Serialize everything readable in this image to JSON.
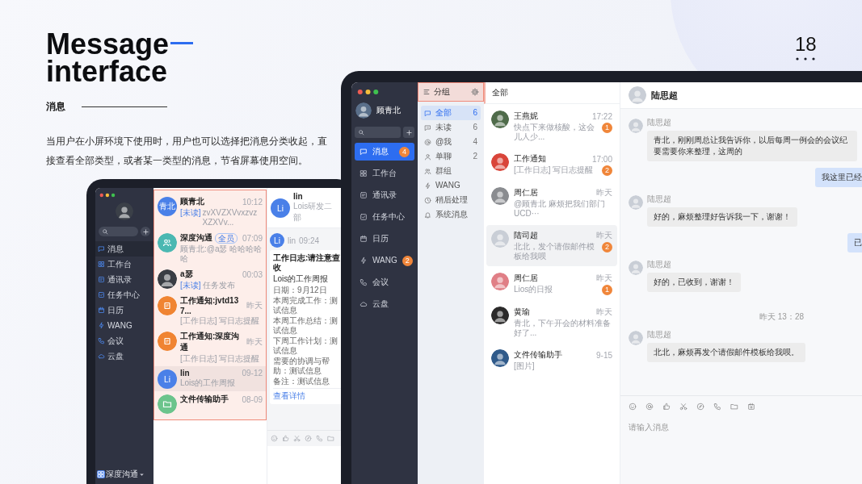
{
  "slide": {
    "title": [
      "Message",
      "interface"
    ],
    "section": "消息",
    "description": "当用户在小屏环境下使用时，用户也可以选择把消息分类收起，直接查看全部类型，或者某一类型的消息，节省屏幕使用空间。",
    "page_number": "18"
  },
  "small_app": {
    "user_avatar": {
      "kind": "photo",
      "color": "#3b4048"
    },
    "nav": [
      {
        "label": "消息",
        "selected": true
      },
      {
        "label": "工作台",
        "selected": false
      },
      {
        "label": "通讯录",
        "selected": false
      },
      {
        "label": "任务中心",
        "selected": false
      },
      {
        "label": "日历",
        "selected": false
      },
      {
        "label": "WANG",
        "selected": false
      },
      {
        "label": "会议",
        "selected": false
      },
      {
        "label": "云盘",
        "selected": false
      }
    ],
    "footer": "深度沟通",
    "conversations": [
      {
        "avatar": {
          "kind": "text",
          "text": "青北",
          "color": "#4a80e8"
        },
        "name": "顾青北",
        "time": "10:12",
        "unread_tag": "[未读]",
        "preview": "zvXVZXVvxzvzXZXVv...",
        "selected": false
      },
      {
        "avatar": {
          "kind": "icon",
          "color": "#4bb8b2"
        },
        "name": "深度沟通",
        "tag": "全员",
        "time": "07:09",
        "preview": "顾青北:@a瑟 哈哈哈哈哈",
        "selected": false
      },
      {
        "avatar": {
          "kind": "photo",
          "color": "#3a3d44"
        },
        "name": "a瑟",
        "time": "00:03",
        "unread_tag": "[未读]",
        "preview": "任务发布",
        "selected": false
      },
      {
        "avatar": {
          "kind": "icon",
          "color": "#f08432"
        },
        "name": "工作通知:jvtd137...",
        "time": "昨天",
        "preview": "[工作日志] 写日志提醒",
        "selected": false
      },
      {
        "avatar": {
          "kind": "icon",
          "color": "#f08432"
        },
        "name": "工作通知:深度沟通",
        "time": "昨天",
        "preview": "[工作日志] 写日志提醒",
        "selected": false
      },
      {
        "avatar": {
          "kind": "text",
          "text": "Li",
          "color": "#4a80e8"
        },
        "name": "lin",
        "time": "09-12",
        "preview": "Lois的工作周报",
        "selected": true
      },
      {
        "avatar": {
          "kind": "icon",
          "color": "#6cc48c"
        },
        "name": "文件传输助手",
        "time": "08-09",
        "selected": false
      }
    ],
    "chat": {
      "avatar": {
        "kind": "text",
        "text": "Li",
        "color": "#4a80e8"
      },
      "name": "lin",
      "subtitle": "Lois研发二部",
      "message": {
        "avatar": {
          "kind": "text",
          "text": "Li",
          "color": "#4a80e8"
        },
        "sender": "lin",
        "time": "09:24",
        "card": {
          "title": "工作日志:请注意查收",
          "subtitle": "Lois的工作周报",
          "lines": [
            "日期：9月12日",
            "本周完成工作：测试信息",
            "本周工作总结：测试信息",
            "下周工作计划：测试信息",
            "需要的协调与帮助：测试信息",
            "备注：测试信息"
          ],
          "link": "查看详情"
        }
      }
    }
  },
  "big_app": {
    "user": {
      "name": "顾青北",
      "avatar": {
        "kind": "photo",
        "color": "#5a6f8a"
      }
    },
    "nav": [
      {
        "label": "消息",
        "selected": true,
        "badge": "4"
      },
      {
        "label": "工作台",
        "selected": false
      },
      {
        "label": "通讯录",
        "selected": false
      },
      {
        "label": "任务中心",
        "selected": false
      },
      {
        "label": "日历",
        "selected": false
      },
      {
        "label": "WANG",
        "selected": false,
        "badge": "2"
      },
      {
        "label": "会议",
        "selected": false
      },
      {
        "label": "云盘",
        "selected": false
      }
    ],
    "groups_header": "分组",
    "groups": [
      {
        "label": "全部",
        "count": "6",
        "selected": true
      },
      {
        "label": "未读",
        "count": "6",
        "selected": false
      },
      {
        "label": "@我",
        "count": "4",
        "selected": false
      },
      {
        "label": "单聊",
        "count": "2",
        "selected": false
      },
      {
        "label": "群组",
        "selected": false
      },
      {
        "label": "WANG",
        "selected": false
      },
      {
        "label": "稍后处理",
        "selected": false
      },
      {
        "label": "系统消息",
        "selected": false
      }
    ],
    "list_header": "全部",
    "conversations": [
      {
        "avatar": {
          "kind": "photo",
          "color": "#4f6b4a"
        },
        "name": "王燕妮",
        "time": "17:22",
        "preview": "快点下来做核酸，这会儿人少...",
        "badge": "1",
        "selected": false
      },
      {
        "avatar": {
          "kind": "photo",
          "color": "#d9453a"
        },
        "name": "工作通知",
        "time": "17:00",
        "preview": "[工作日志] 写日志提醒",
        "badge": "2",
        "selected": false
      },
      {
        "avatar": {
          "kind": "photo",
          "color": "#8a8c90"
        },
        "name": "周仁居",
        "time": "昨天",
        "preview": "@顾青北 麻烦把我们部门UCD···",
        "selected": false
      },
      {
        "avatar": {
          "kind": "photo",
          "color": "#c9ced6"
        },
        "name": "陆司超",
        "time": "昨天",
        "preview": "北北，发个请假邮件模板给我呗",
        "badge": "2",
        "selected": true
      },
      {
        "avatar": {
          "kind": "photo",
          "color": "#e07f86"
        },
        "name": "周仁居",
        "time": "昨天",
        "preview": "Lios的日报",
        "badge": "1",
        "selected": false
      },
      {
        "avatar": {
          "kind": "photo",
          "color": "#2b2a2a"
        },
        "name": "黄瑜",
        "time": "昨天",
        "preview": "青北，下午开会的材料准备好了...",
        "selected": false
      },
      {
        "avatar": {
          "kind": "photo",
          "color": "#2f5a8a"
        },
        "name": "文件传输助手",
        "time": "9-15",
        "preview": "[图片]",
        "selected": false
      }
    ],
    "chat": {
      "name": "陆思超",
      "avatar": {
        "kind": "photo",
        "color": "#c9ced6"
      },
      "messages": [
        {
          "kind": "incoming",
          "sender": "陆思超",
          "avatar": {
            "kind": "photo",
            "color": "#c9ced6"
          },
          "text": "青北，刚刚周总让我告诉你，以后每周一例会的会议纪要需要你来整理，这周的"
        },
        {
          "kind": "outgoing",
          "text": "我这里已经"
        },
        {
          "kind": "incoming",
          "sender": "陆思超",
          "avatar": {
            "kind": "photo",
            "color": "#c9ced6"
          },
          "text": "好的，麻烦整理好告诉我一下，谢谢！"
        },
        {
          "kind": "outgoing",
          "text": "已"
        },
        {
          "kind": "incoming",
          "sender": "陆思超",
          "avatar": {
            "kind": "photo",
            "color": "#c9ced6"
          },
          "text": "好的，已收到，谢谢！"
        },
        {
          "kind": "timestamp",
          "text": "昨天 13：28"
        },
        {
          "kind": "incoming",
          "sender": "陆思超",
          "avatar": {
            "kind": "photo",
            "color": "#c9ced6"
          },
          "text": "北北，麻烦再发个请假邮件模板给我呗。"
        }
      ],
      "input_placeholder": "请输入消息"
    }
  }
}
